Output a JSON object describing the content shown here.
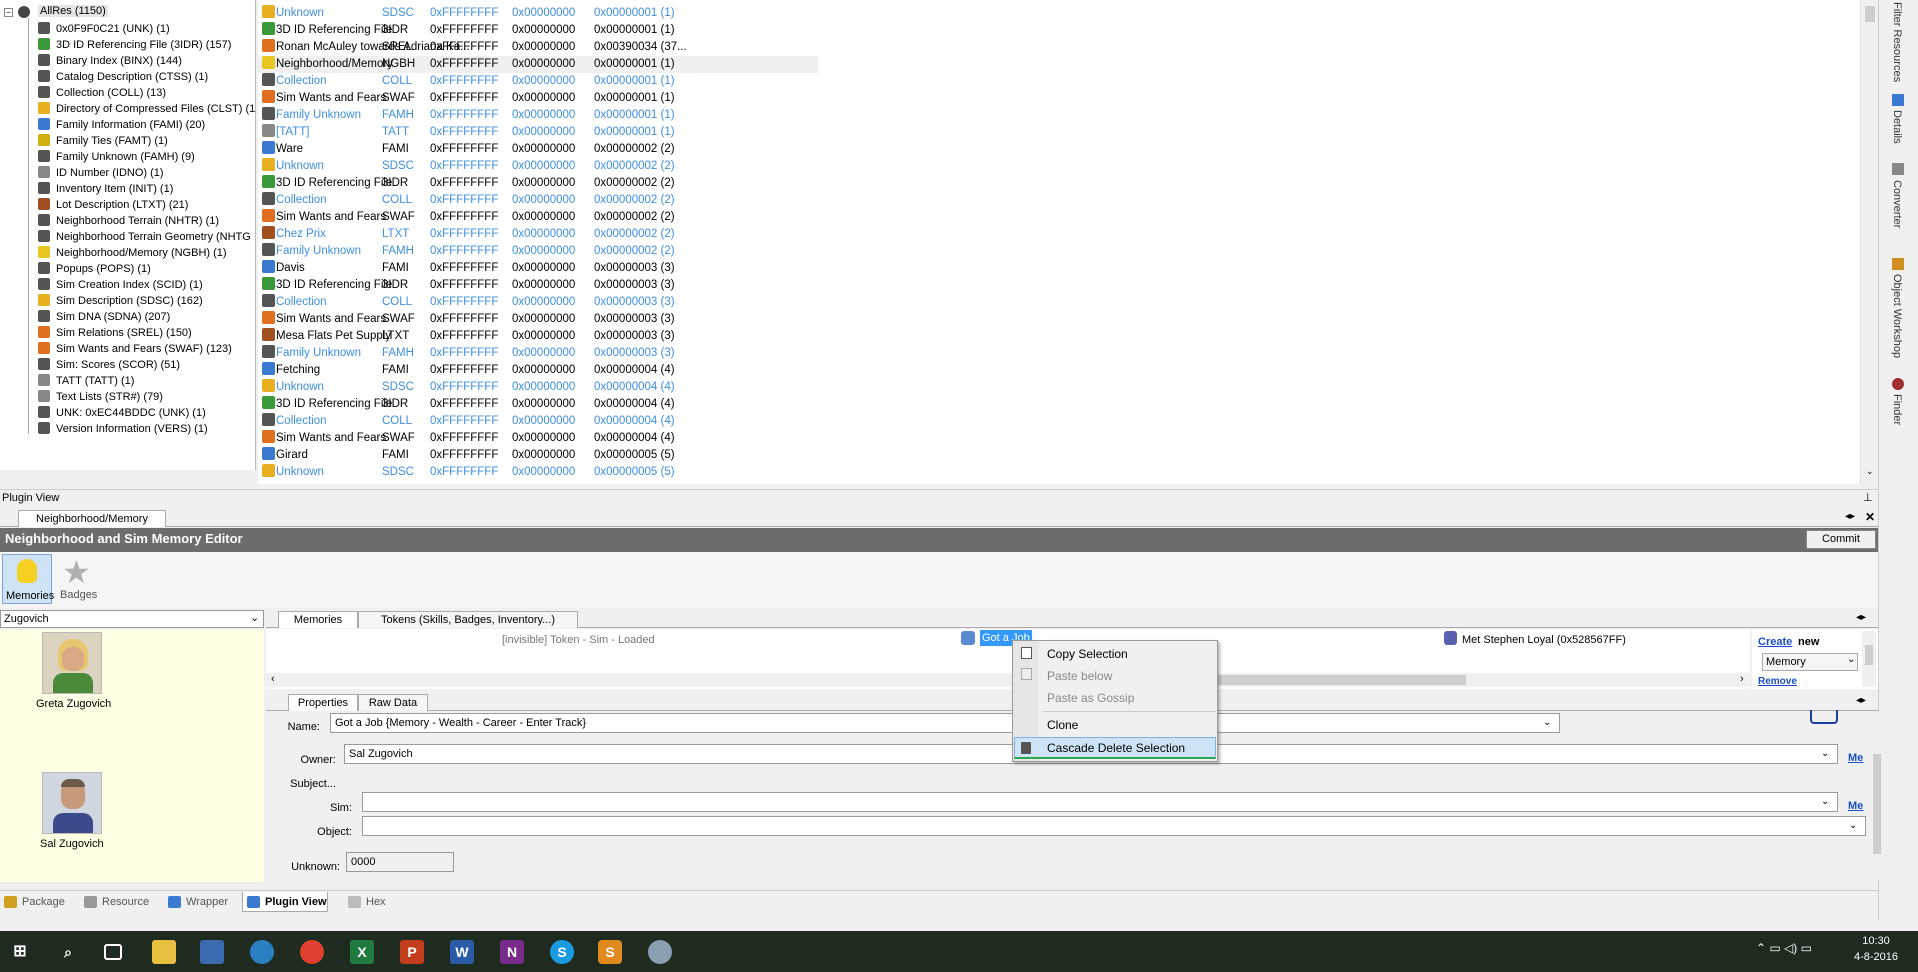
{
  "tree": {
    "root_label": "AllRes (1150)",
    "items": [
      "0x0F9F0C21 (UNK) (1)",
      "3D ID Referencing File (3IDR) (157)",
      "Binary Index (BINX) (144)",
      "Catalog Description (CTSS) (1)",
      "Collection (COLL) (13)",
      "Directory of Compressed Files (CLST) (1)",
      "Family Information (FAMI) (20)",
      "Family Ties (FAMT) (1)",
      "Family Unknown (FAMH) (9)",
      "ID Number (IDNO) (1)",
      "Inventory Item (INIT) (1)",
      "Lot Description (LTXT) (21)",
      "Neighborhood Terrain (NHTR) (1)",
      "Neighborhood Terrain Geometry (NHTG",
      "Neighborhood/Memory (NGBH) (1)",
      "Popups (POPS) (1)",
      "Sim Creation Index (SCID) (1)",
      "Sim Description (SDSC) (162)",
      "Sim DNA (SDNA) (207)",
      "Sim Relations (SREL) (150)",
      "Sim Wants and Fears (SWAF) (123)",
      "Sim: Scores (SCOR) (51)",
      "TATT (TATT) (1)",
      "Text Lists (STR#) (79)",
      "UNK: 0xEC44BDDC (UNK) (1)",
      "Version Information (VERS) (1)"
    ],
    "icon_colors": [
      "#555",
      "#3a9a3a",
      "#555",
      "#555",
      "#555",
      "#e8b020",
      "#3a7ad0",
      "#d0b010",
      "#555",
      "#888",
      "#555",
      "#a05020",
      "#555",
      "#555",
      "#e8c820",
      "#555",
      "#555",
      "#e8b020",
      "#555",
      "#e07020",
      "#e07020",
      "#555",
      "#888",
      "#888",
      "#555",
      "#555"
    ]
  },
  "list": {
    "rows": [
      {
        "name": "Unknown",
        "type": "SDSC",
        "group": "0xFFFFFFFF",
        "hi": "0x00000000",
        "inst": "0x00000001 (1)",
        "gray": true,
        "icon": "#e8b020"
      },
      {
        "name": "3D ID Referencing File",
        "type": "3IDR",
        "group": "0xFFFFFFFF",
        "hi": "0x00000000",
        "inst": "0x00000001 (1)",
        "gray": false,
        "icon": "#3a9a3a"
      },
      {
        "name": "Ronan McAuley towards Adriana Ka...",
        "type": "SREL",
        "group": "0xFFFFFFFF",
        "hi": "0x00000000",
        "inst": "0x00390034 (37...",
        "gray": false,
        "icon": "#e07020"
      },
      {
        "name": "Neighborhood/Memory",
        "type": "NGBH",
        "group": "0xFFFFFFFF",
        "hi": "0x00000000",
        "inst": "0x00000001 (1)",
        "gray": false,
        "sel": true,
        "icon": "#e8c820"
      },
      {
        "name": "Collection",
        "type": "COLL",
        "group": "0xFFFFFFFF",
        "hi": "0x00000000",
        "inst": "0x00000001 (1)",
        "gray": true,
        "icon": "#555"
      },
      {
        "name": "Sim Wants and Fears",
        "type": "SWAF",
        "group": "0xFFFFFFFF",
        "hi": "0x00000000",
        "inst": "0x00000001 (1)",
        "gray": false,
        "icon": "#e07020"
      },
      {
        "name": "Family Unknown",
        "type": "FAMH",
        "group": "0xFFFFFFFF",
        "hi": "0x00000000",
        "inst": "0x00000001 (1)",
        "gray": true,
        "icon": "#555"
      },
      {
        "name": "[TATT]",
        "type": "TATT",
        "group": "0xFFFFFFFF",
        "hi": "0x00000000",
        "inst": "0x00000001 (1)",
        "gray": true,
        "icon": "#888"
      },
      {
        "name": "Ware",
        "type": "FAMI",
        "group": "0xFFFFFFFF",
        "hi": "0x00000000",
        "inst": "0x00000002 (2)",
        "gray": false,
        "icon": "#3a7ad0"
      },
      {
        "name": "Unknown",
        "type": "SDSC",
        "group": "0xFFFFFFFF",
        "hi": "0x00000000",
        "inst": "0x00000002 (2)",
        "gray": true,
        "icon": "#e8b020"
      },
      {
        "name": "3D ID Referencing File",
        "type": "3IDR",
        "group": "0xFFFFFFFF",
        "hi": "0x00000000",
        "inst": "0x00000002 (2)",
        "gray": false,
        "icon": "#3a9a3a"
      },
      {
        "name": "Collection",
        "type": "COLL",
        "group": "0xFFFFFFFF",
        "hi": "0x00000000",
        "inst": "0x00000002 (2)",
        "gray": true,
        "icon": "#555"
      },
      {
        "name": "Sim Wants and Fears",
        "type": "SWAF",
        "group": "0xFFFFFFFF",
        "hi": "0x00000000",
        "inst": "0x00000002 (2)",
        "gray": false,
        "icon": "#e07020"
      },
      {
        "name": "Chez Prix",
        "type": "LTXT",
        "group": "0xFFFFFFFF",
        "hi": "0x00000000",
        "inst": "0x00000002 (2)",
        "gray": true,
        "icon": "#a05020"
      },
      {
        "name": "Family Unknown",
        "type": "FAMH",
        "group": "0xFFFFFFFF",
        "hi": "0x00000000",
        "inst": "0x00000002 (2)",
        "gray": true,
        "icon": "#555"
      },
      {
        "name": "Davis",
        "type": "FAMI",
        "group": "0xFFFFFFFF",
        "hi": "0x00000000",
        "inst": "0x00000003 (3)",
        "gray": false,
        "icon": "#3a7ad0"
      },
      {
        "name": "3D ID Referencing File",
        "type": "3IDR",
        "group": "0xFFFFFFFF",
        "hi": "0x00000000",
        "inst": "0x00000003 (3)",
        "gray": false,
        "icon": "#3a9a3a"
      },
      {
        "name": "Collection",
        "type": "COLL",
        "group": "0xFFFFFFFF",
        "hi": "0x00000000",
        "inst": "0x00000003 (3)",
        "gray": true,
        "icon": "#555"
      },
      {
        "name": "Sim Wants and Fears",
        "type": "SWAF",
        "group": "0xFFFFFFFF",
        "hi": "0x00000000",
        "inst": "0x00000003 (3)",
        "gray": false,
        "icon": "#e07020"
      },
      {
        "name": "Mesa Flats Pet Supply",
        "type": "LTXT",
        "group": "0xFFFFFFFF",
        "hi": "0x00000000",
        "inst": "0x00000003 (3)",
        "gray": false,
        "icon": "#a05020"
      },
      {
        "name": "Family Unknown",
        "type": "FAMH",
        "group": "0xFFFFFFFF",
        "hi": "0x00000000",
        "inst": "0x00000003 (3)",
        "gray": true,
        "icon": "#555"
      },
      {
        "name": "Fetching",
        "type": "FAMI",
        "group": "0xFFFFFFFF",
        "hi": "0x00000000",
        "inst": "0x00000004 (4)",
        "gray": false,
        "icon": "#3a7ad0"
      },
      {
        "name": "Unknown",
        "type": "SDSC",
        "group": "0xFFFFFFFF",
        "hi": "0x00000000",
        "inst": "0x00000004 (4)",
        "gray": true,
        "icon": "#e8b020"
      },
      {
        "name": "3D ID Referencing File",
        "type": "3IDR",
        "group": "0xFFFFFFFF",
        "hi": "0x00000000",
        "inst": "0x00000004 (4)",
        "gray": false,
        "icon": "#3a9a3a"
      },
      {
        "name": "Collection",
        "type": "COLL",
        "group": "0xFFFFFFFF",
        "hi": "0x00000000",
        "inst": "0x00000004 (4)",
        "gray": true,
        "icon": "#555"
      },
      {
        "name": "Sim Wants and Fears",
        "type": "SWAF",
        "group": "0xFFFFFFFF",
        "hi": "0x00000000",
        "inst": "0x00000004 (4)",
        "gray": false,
        "icon": "#e07020"
      },
      {
        "name": "Girard",
        "type": "FAMI",
        "group": "0xFFFFFFFF",
        "hi": "0x00000000",
        "inst": "0x00000005 (5)",
        "gray": false,
        "icon": "#3a7ad0"
      },
      {
        "name": "Unknown",
        "type": "SDSC",
        "group": "0xFFFFFFFF",
        "hi": "0x00000000",
        "inst": "0x00000005 (5)",
        "gray": true,
        "icon": "#e8b020"
      }
    ]
  },
  "side_tabs": [
    "Filter Resources",
    "Details",
    "Converter",
    "Object Workshop",
    "Finder"
  ],
  "plugin": {
    "panel_title": "Plugin View",
    "doc_tab": "Neighborhood/Memory",
    "editor_title": "Neighborhood and Sim Memory Editor",
    "commit_label": "Commit",
    "modes": [
      "Memories",
      "Badges"
    ],
    "family_select": "Zugovich",
    "sims": [
      "Greta Zugovich",
      "Sal Zugovich"
    ],
    "tabs": [
      "Memories",
      "Tokens (Skills, Badges, Inventory...)"
    ],
    "memory_items": {
      "invisible": "[invisible] Token - Sim - Loaded",
      "selected": "Got a Job",
      "met": "Met Stephen Loyal (0x528567FF)"
    },
    "create_link": "Create",
    "create_suffix": "new",
    "create_type": "Memory",
    "remove_link": "Remove",
    "prop_tabs": [
      "Properties",
      "Raw Data"
    ],
    "labels": {
      "name": "Name:",
      "owner": "Owner:",
      "subject": "Subject...",
      "sim": "Sim:",
      "object": "Object:",
      "unknown": "Unknown:"
    },
    "name_value": "Got a Job {Memory - Wealth - Career - Enter Track}",
    "owner_value": "Sal Zugovich",
    "sim_value": "",
    "object_value": "",
    "unknown_value": "0000",
    "me_link": "Me"
  },
  "context_menu": {
    "items": [
      "Copy Selection",
      "Paste below",
      "Paste as Gossip",
      "Clone",
      "Cascade Delete Selection"
    ]
  },
  "bottom_tabs": [
    "Package",
    "Resource",
    "Wrapper",
    "Plugin View",
    "Hex"
  ],
  "taskbar": {
    "time": "10:30",
    "date": "4-8-2016"
  }
}
